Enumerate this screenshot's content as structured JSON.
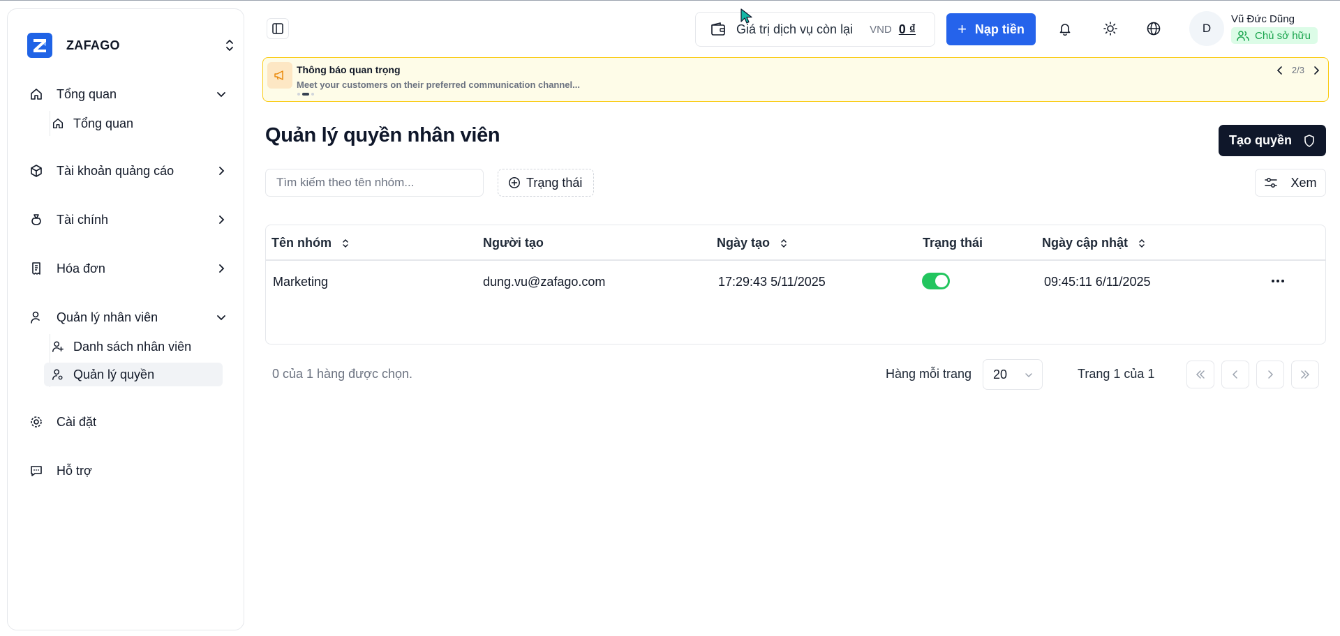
{
  "brand": {
    "name": "ZAFAGO",
    "logo_letter": "Z"
  },
  "sidebar": {
    "groups": [
      {
        "label": "Tổng quan",
        "icon": "home-icon",
        "expanded": true,
        "children": [
          {
            "label": "Tổng quan",
            "icon": "home-icon"
          }
        ]
      },
      {
        "label": "Tài khoản quảng cáo",
        "icon": "box-icon",
        "expanded": false
      },
      {
        "label": "Tài chính",
        "icon": "money-bag-icon",
        "expanded": false
      },
      {
        "label": "Hóa đơn",
        "icon": "receipt-icon",
        "expanded": false
      },
      {
        "label": "Quản lý nhân viên",
        "icon": "user-icon",
        "expanded": true,
        "children": [
          {
            "label": "Danh sách nhân viên",
            "icon": "user-plus-icon"
          },
          {
            "label": "Quản lý quyền",
            "icon": "user-key-icon",
            "active": true
          }
        ]
      },
      {
        "label": "Cài đặt",
        "icon": "gear-icon"
      },
      {
        "label": "Hỗ trợ",
        "icon": "chat-icon"
      }
    ]
  },
  "header": {
    "balance_label": "Giá trị dịch vụ còn lại",
    "currency": "VND",
    "balance_value": "0 ₫",
    "topup_label": "Nạp tiền",
    "user": {
      "initial": "D",
      "name": "Vũ Đức Dũng",
      "role": "Chủ sở hữu"
    }
  },
  "notice": {
    "title": "Thông báo quan trọng",
    "text": "Meet your customers on their preferred communication channel...",
    "pager": "2/3",
    "current_index": 2,
    "total": 3
  },
  "page": {
    "title": "Quản lý quyền nhân viên",
    "create_label": "Tạo quyền",
    "search_placeholder": "Tìm kiếm theo tên nhóm...",
    "status_filter_label": "Trạng thái",
    "view_label": "Xem"
  },
  "table": {
    "columns": [
      "Tên nhóm",
      "Người tạo",
      "Ngày tạo",
      "Trạng thái",
      "Ngày cập nhật"
    ],
    "rows": [
      {
        "name": "Marketing",
        "creator": "dung.vu@zafago.com",
        "created": "17:29:43 5/11/2025",
        "active": true,
        "updated": "09:45:11 6/11/2025"
      }
    ]
  },
  "footer": {
    "selected_info": "0 của 1 hàng được chọn.",
    "rows_per_page_label": "Hàng mỗi trang",
    "rows_per_page": "20",
    "page_info": "Trang 1 của 1"
  },
  "colors": {
    "primary": "#2563eb",
    "dark": "#0f172a",
    "success": "#22c55e",
    "notice_bg": "#fefce8",
    "notice_border": "#facc15"
  }
}
